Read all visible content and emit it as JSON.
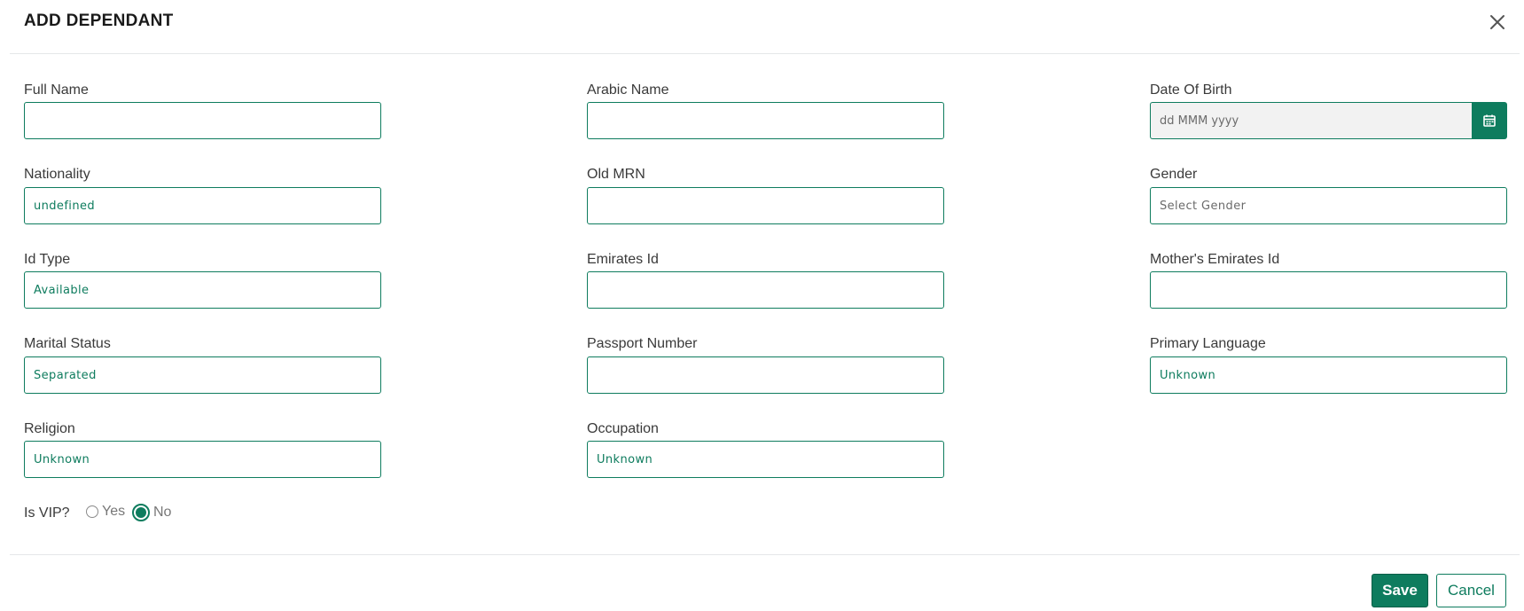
{
  "modal": {
    "title": "ADD DEPENDANT"
  },
  "fields": {
    "full_name": {
      "label": "Full Name",
      "value": ""
    },
    "arabic_name": {
      "label": "Arabic Name",
      "value": ""
    },
    "date_of_birth": {
      "label": "Date Of Birth",
      "placeholder": "dd MMM yyyy",
      "value": ""
    },
    "nationality": {
      "label": "Nationality",
      "value": "undefined"
    },
    "old_mrn": {
      "label": "Old MRN",
      "value": ""
    },
    "gender": {
      "label": "Gender",
      "placeholder": "Select Gender"
    },
    "id_type": {
      "label": "Id Type",
      "value": "Available"
    },
    "emirates_id": {
      "label": "Emirates Id",
      "value": ""
    },
    "mothers_emirates_id": {
      "label": "Mother's Emirates Id",
      "value": ""
    },
    "marital_status": {
      "label": "Marital Status",
      "value": "Separated"
    },
    "passport_number": {
      "label": "Passport Number",
      "value": ""
    },
    "primary_language": {
      "label": "Primary Language",
      "value": "Unknown"
    },
    "religion": {
      "label": "Religion",
      "value": "Unknown"
    },
    "occupation": {
      "label": "Occupation",
      "value": "Unknown"
    }
  },
  "vip": {
    "label": "Is VIP?",
    "options": [
      {
        "label": "Yes",
        "selected": false
      },
      {
        "label": "No",
        "selected": true
      }
    ]
  },
  "footer": {
    "save_label": "Save",
    "cancel_label": "Cancel"
  },
  "colors": {
    "accent": "#0e7c5e",
    "border": "#e5e7e9"
  },
  "icons": {
    "close": "close-icon",
    "calendar": "calendar-icon"
  }
}
